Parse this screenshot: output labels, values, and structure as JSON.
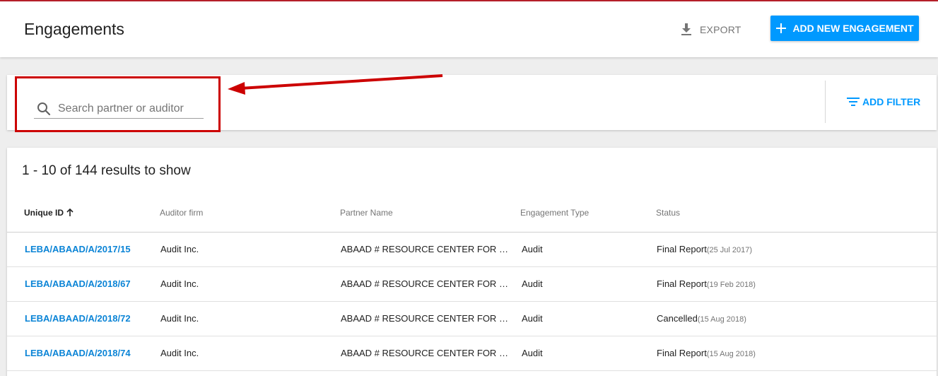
{
  "header": {
    "title": "Engagements",
    "export_label": "EXPORT",
    "add_label": "ADD NEW ENGAGEMENT"
  },
  "filter": {
    "search_placeholder": "Search partner or auditor",
    "search_value": "",
    "add_filter_label": "ADD FILTER"
  },
  "results": {
    "count_text": "1 - 10 of 144 results to show",
    "columns": [
      "Unique ID",
      "Auditor firm",
      "Partner Name",
      "Engagement Type",
      "Status"
    ],
    "rows": [
      {
        "id": "LEBA/ABAAD/A/2017/15",
        "firm": "Audit Inc.",
        "partner": "ABAAD # RESOURCE CENTER FOR GENDER EQUALITY",
        "type": "Audit",
        "status": "Final Report",
        "date": "(25 Jul 2017)"
      },
      {
        "id": "LEBA/ABAAD/A/2018/67",
        "firm": "Audit Inc.",
        "partner": "ABAAD # RESOURCE CENTER FOR GENDER EQUALITY",
        "type": "Audit",
        "status": "Final Report",
        "date": "(19 Feb 2018)"
      },
      {
        "id": "LEBA/ABAAD/A/2018/72",
        "firm": "Audit Inc.",
        "partner": "ABAAD # RESOURCE CENTER FOR GENDER EQUALITY",
        "type": "Audit",
        "status": "Cancelled",
        "date": "(15 Aug 2018)"
      },
      {
        "id": "LEBA/ABAAD/A/2018/74",
        "firm": "Audit Inc.",
        "partner": "ABAAD # RESOURCE CENTER FOR GENDER EQUALITY",
        "type": "Audit",
        "status": "Final Report",
        "date": "(15 Aug 2018)"
      }
    ]
  },
  "icons": {
    "export": "download-icon",
    "add": "plus-icon",
    "search": "search-icon",
    "filter": "filter-icon",
    "sort": "arrow-up-icon"
  },
  "colors": {
    "accent": "#0099ff",
    "link": "#0b84d6",
    "annotation": "#cc0000"
  }
}
